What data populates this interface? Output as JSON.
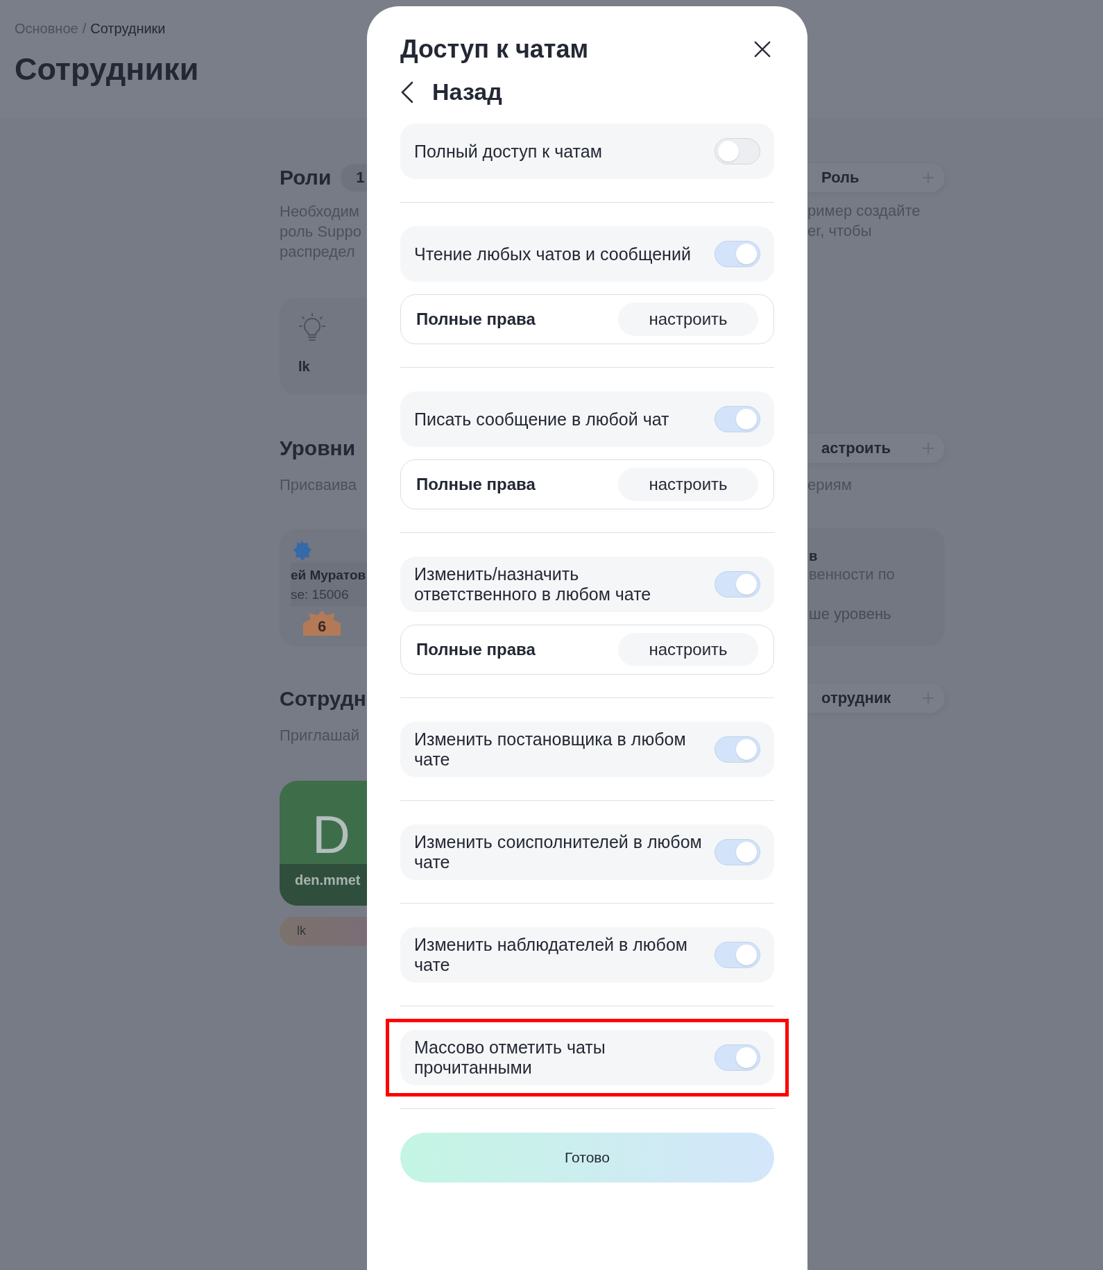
{
  "breadcrumb": {
    "parent": "Основное",
    "separator": "/",
    "current": "Сотрудники"
  },
  "page_title": "Сотрудники",
  "background": {
    "left": {
      "roles_title": "Роли",
      "roles_count": "1",
      "roles_desc": [
        "Необходим",
        "роль Suppo",
        "распредел"
      ],
      "role_card_label": "lk",
      "levels_title": "Уровни",
      "levels_desc": "Присваива",
      "level_card_name": "ей Муратов",
      "level_card_sub": "se: 15006",
      "level_card_badge": "6",
      "staff_title": "Сотрудн",
      "staff_desc": "Приглашай",
      "avatar_initials": "D",
      "avatar_name": "den.mmet",
      "tag": "lk"
    },
    "right": {
      "role_button": "Роль",
      "roles_desc": [
        "ример создайте",
        "er, чтобы"
      ],
      "levels_button": "астроить",
      "levels_desc": "ериям",
      "hint_title": "в",
      "hint_text": "венности по",
      "hint_faded": "ше уровень",
      "staff_button": "отрудник"
    }
  },
  "modal": {
    "title": "Доступ к чатам",
    "back": "Назад",
    "items": [
      {
        "label": "Полный доступ к чатам",
        "on": false,
        "highlighted": false
      },
      {
        "label": "Чтение любых чатов и сообщений",
        "on": true,
        "highlighted": false,
        "sub": {
          "label": "Полные права",
          "button": "настроить"
        }
      },
      {
        "label": "Писать сообщение в любой чат",
        "on": true,
        "highlighted": false,
        "sub": {
          "label": "Полные права",
          "button": "настроить"
        }
      },
      {
        "label": "Изменить/назначить ответственного в любом чате",
        "on": true,
        "highlighted": false,
        "sub": {
          "label": "Полные права",
          "button": "настроить"
        }
      },
      {
        "label": "Изменить постановщика в любом чате",
        "on": true,
        "highlighted": false
      },
      {
        "label": "Изменить соисполнителей в любом чате",
        "on": true,
        "highlighted": false
      },
      {
        "label": "Изменить наблюдателей в любом чате",
        "on": true,
        "highlighted": false
      },
      {
        "label": "Массово отметить чаты прочитанными",
        "on": true,
        "highlighted": true
      }
    ],
    "done": "Готово"
  }
}
